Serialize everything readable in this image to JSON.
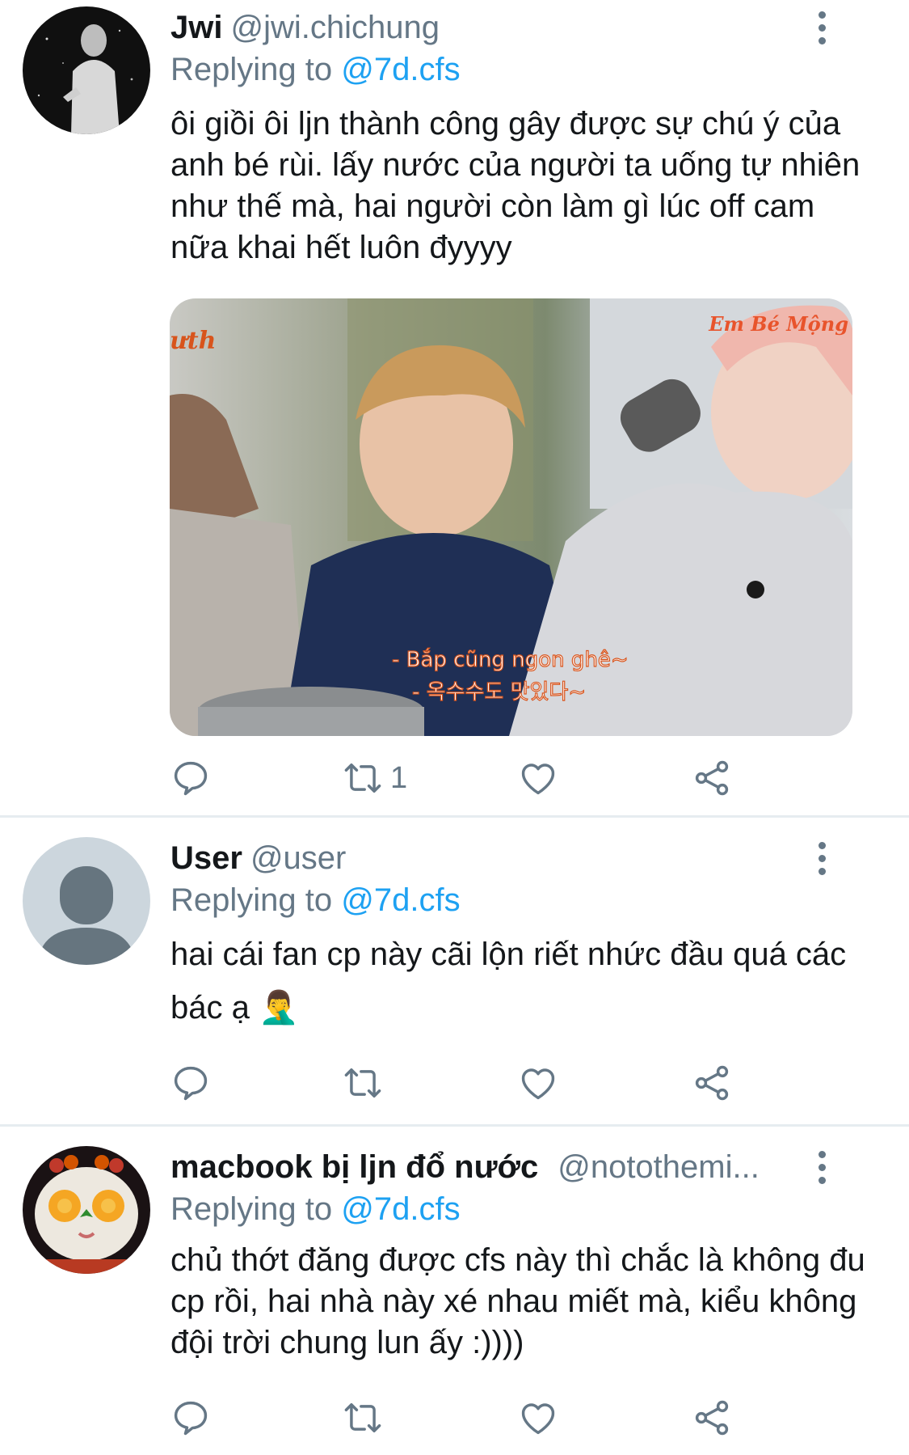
{
  "tweets": [
    {
      "display_name": "Jwi",
      "handle": "@jwi.chichung",
      "replying_prefix": "Replying to",
      "replying_to": "@7d.cfs",
      "text": "ôi giồi ôi ljn thành công gây được sự chú ý của anh bé rùi. lấy nước của người ta uống tự nhiên như thế mà, hai người còn làm gì lúc off cam nữa khai hết luôn đyyyy",
      "media": {
        "watermark_left": "ưth",
        "watermark_right": "Em Bé Mộng",
        "subtitle_vi": "- Bắp cũng ngon ghê~",
        "subtitle_ko": "- 옥수수도 맛있다~"
      },
      "retweet_count": "1"
    },
    {
      "display_name": "User",
      "handle": "@user",
      "replying_prefix": "Replying to",
      "replying_to": "@7d.cfs",
      "text": "hai cái fan cp này cãi lộn riết nhức đầu quá các bác ạ 🤦‍♂️"
    },
    {
      "display_name": "macbook bị ljn đổ nước",
      "handle": "@notothemi...",
      "replying_prefix": "Replying to",
      "replying_to": "@7d.cfs",
      "text": "chủ thớt đăng được cfs này thì chắc là không đu cp rồi, hai nhà này xé nhau miết mà, kiểu không đội trời chung lun ấy :))))"
    }
  ],
  "icons": [
    "reply-icon",
    "retweet-icon",
    "like-icon",
    "share-icon",
    "more-icon"
  ],
  "colors": {
    "link": "#1da1f2",
    "secondary": "#657786",
    "text": "#14171a",
    "divider": "#e6ecf0"
  }
}
